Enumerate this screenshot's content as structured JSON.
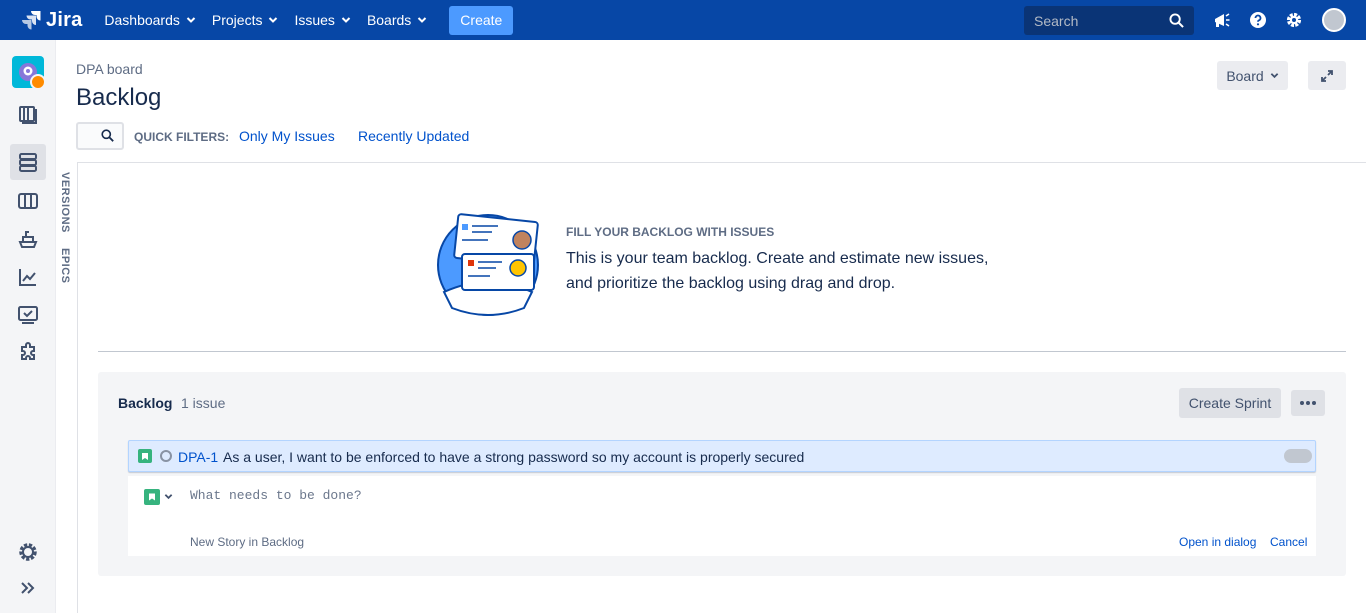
{
  "topnav": {
    "logo": "Jira",
    "items": [
      "Dashboards",
      "Projects",
      "Issues",
      "Boards"
    ],
    "create_label": "Create",
    "search_placeholder": "Search"
  },
  "header": {
    "breadcrumb": "DPA board",
    "title": "Backlog",
    "board_button": "Board",
    "quick_filters_label": "QUICK FILTERS:",
    "filters": [
      "Only My Issues",
      "Recently Updated"
    ]
  },
  "vtabs": [
    "VERSIONS",
    "EPICS"
  ],
  "empty_state": {
    "title": "FILL YOUR BACKLOG WITH ISSUES",
    "text": "This is your team backlog. Create and estimate new issues, and prioritize the backlog using drag and drop."
  },
  "backlog": {
    "title": "Backlog",
    "count": "1 issue",
    "create_sprint": "Create Sprint",
    "issues": [
      {
        "key": "DPA-1",
        "summary": "As a user, I want to be enforced to have a strong password so my account is properly secured"
      }
    ],
    "create_placeholder": "What needs to be done?",
    "create_hint": "New Story in Backlog",
    "open_dialog": "Open in dialog",
    "cancel": "Cancel"
  },
  "colors": {
    "nav": "#0747a6",
    "create": "#4c9aff",
    "story": "#36b37e",
    "link": "#0052cc"
  },
  "icons": {
    "sidebar": [
      "project-avatar",
      "roadmap-icon",
      "backlog-icon",
      "board-icon",
      "releases-icon",
      "reports-icon",
      "issues-icon",
      "addons-icon",
      "settings-icon",
      "expand-sidebar-icon"
    ],
    "topbar": [
      "notifications-icon",
      "help-icon",
      "settings-icon",
      "profile-avatar"
    ]
  }
}
